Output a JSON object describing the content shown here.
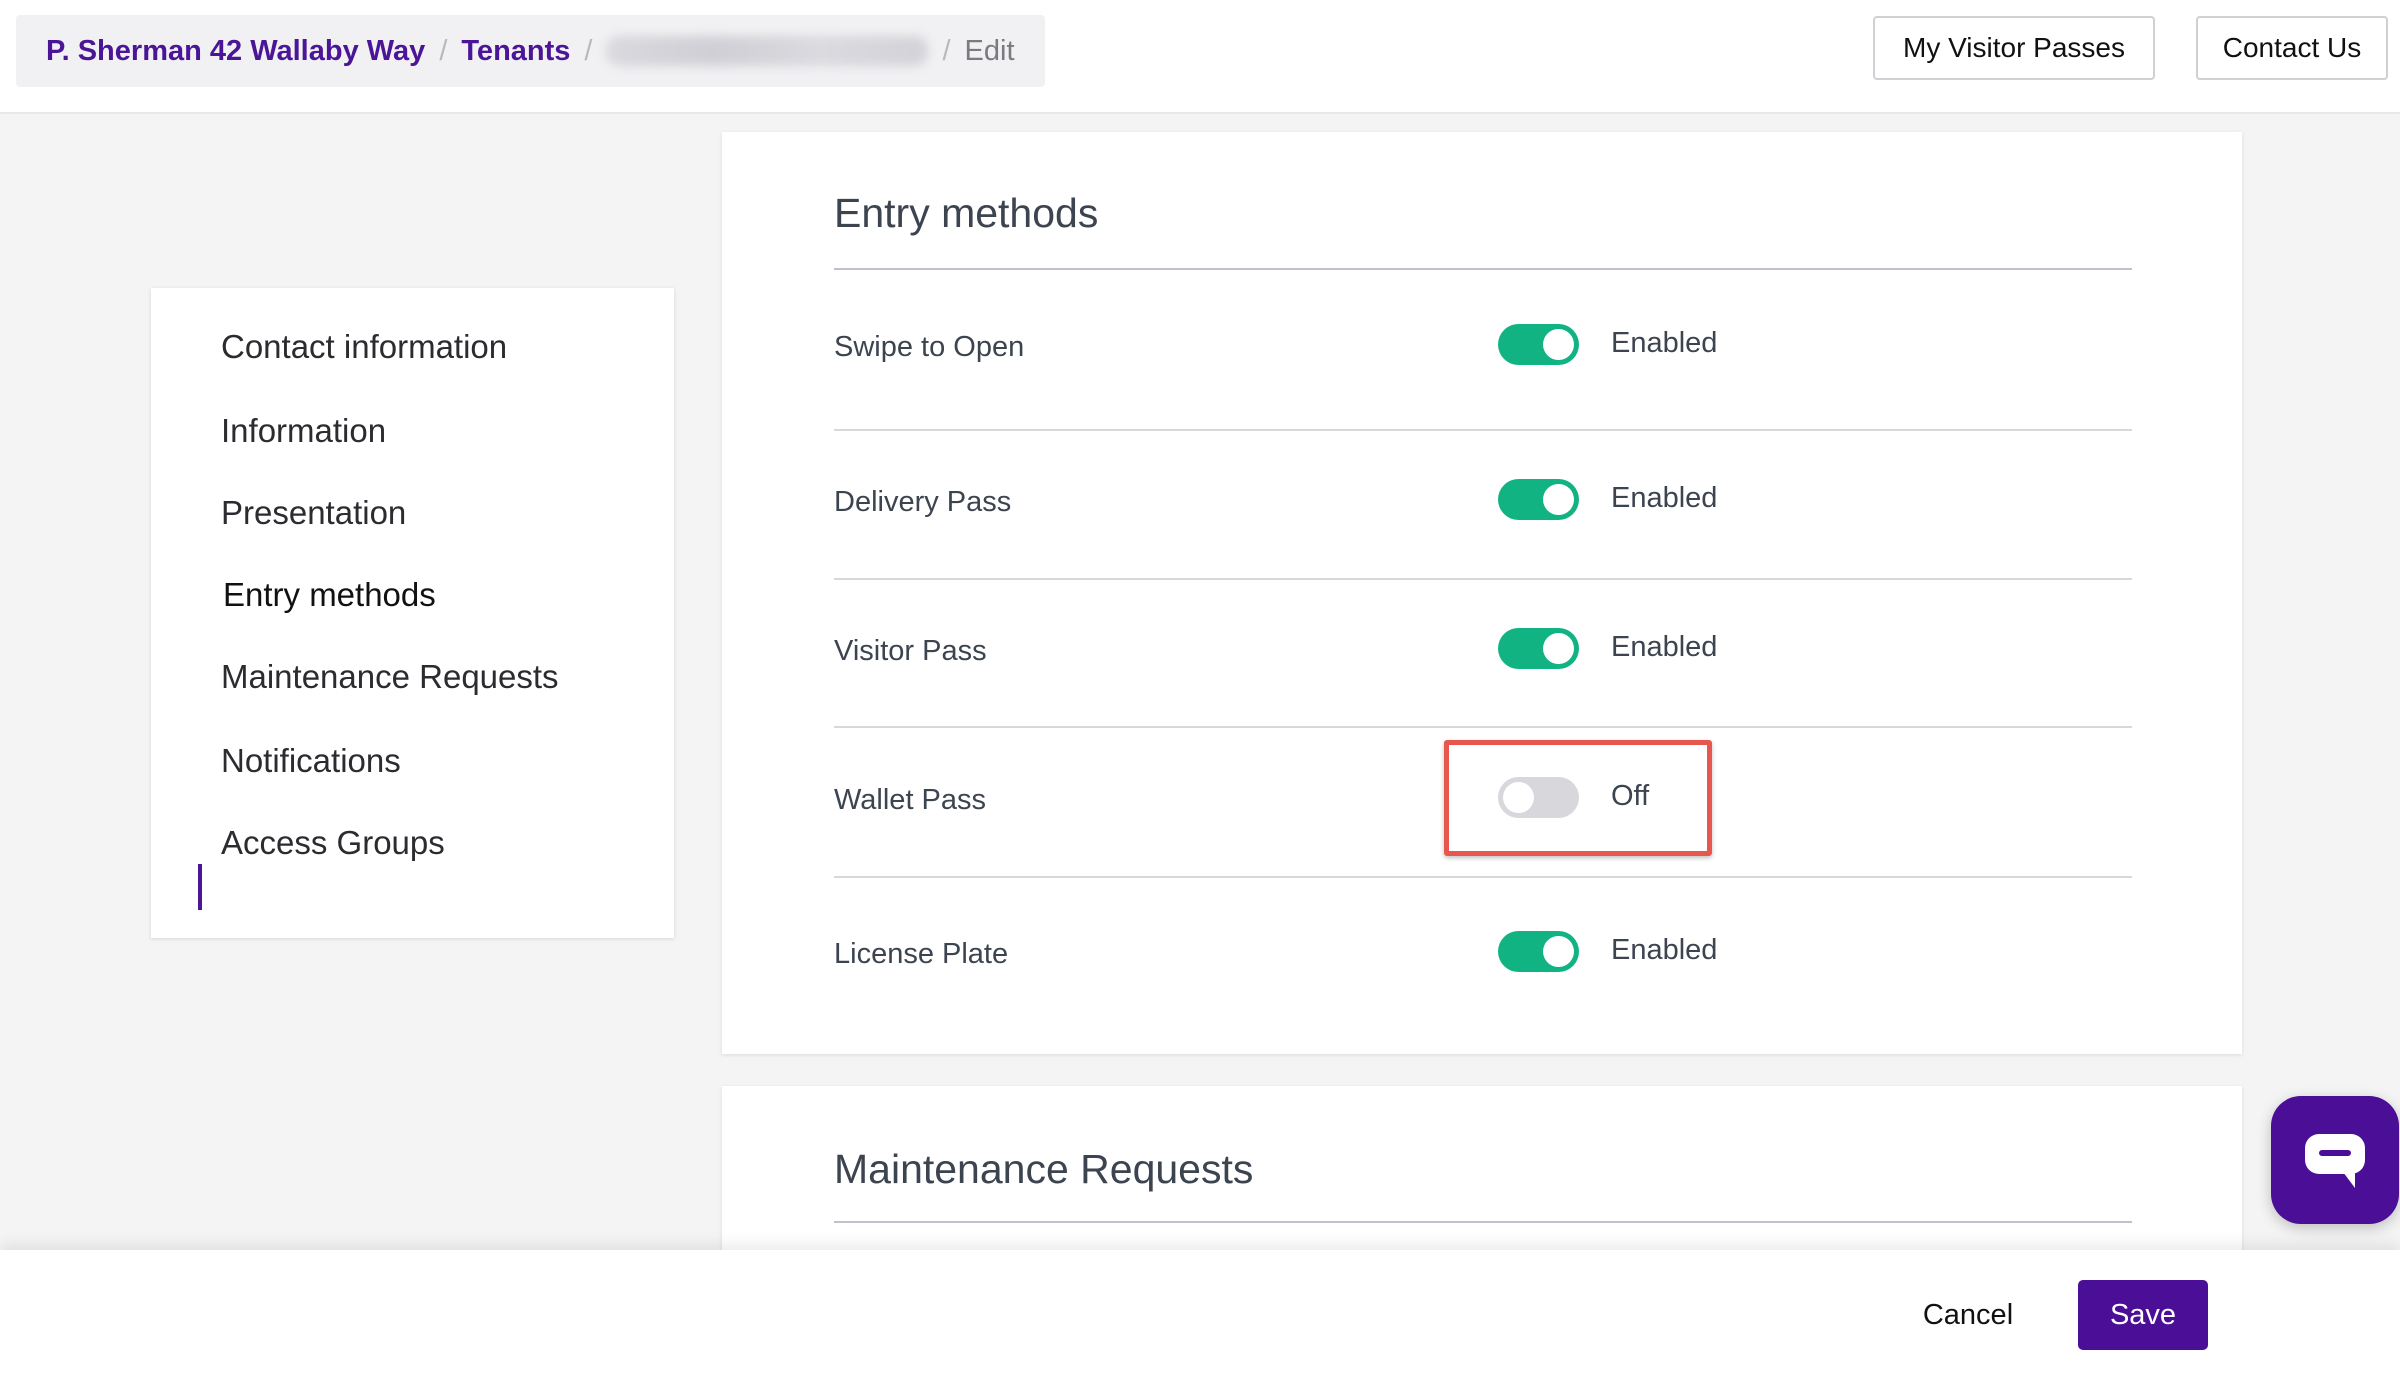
{
  "breadcrumb": {
    "property": "P. Sherman 42 Wallaby Way",
    "section": "Tenants",
    "current": "Edit",
    "separator": "/"
  },
  "header": {
    "visitor_passes_label": "My Visitor Passes",
    "contact_label": "Contact Us"
  },
  "sidebar": {
    "items": [
      {
        "label": "Contact information"
      },
      {
        "label": "Information"
      },
      {
        "label": "Presentation"
      },
      {
        "label": "Entry methods"
      },
      {
        "label": "Maintenance Requests"
      },
      {
        "label": "Notifications"
      },
      {
        "label": "Access Groups"
      }
    ],
    "active_index": 3
  },
  "entry_methods": {
    "title": "Entry methods",
    "rows": [
      {
        "label": "Swipe to Open",
        "state": "Enabled",
        "on": true
      },
      {
        "label": "Delivery Pass",
        "state": "Enabled",
        "on": true
      },
      {
        "label": "Visitor Pass",
        "state": "Enabled",
        "on": true
      },
      {
        "label": "Wallet Pass",
        "state": "Off",
        "on": false
      },
      {
        "label": "License Plate",
        "state": "Enabled",
        "on": true
      }
    ]
  },
  "maintenance": {
    "title": "Maintenance Requests"
  },
  "footer": {
    "cancel_label": "Cancel",
    "save_label": "Save"
  },
  "colors": {
    "brand": "#4a0f96",
    "toggle_on": "#12b382",
    "toggle_off": "#d8d8dc",
    "highlight": "#e8574e"
  }
}
